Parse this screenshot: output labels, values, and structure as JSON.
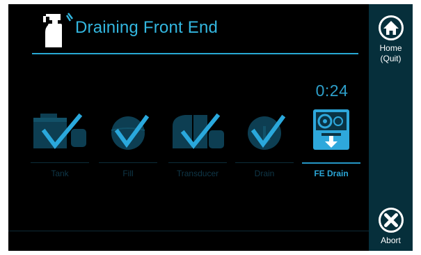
{
  "header": {
    "title": "Draining Front End",
    "icon": "spray-bottle-icon"
  },
  "timer": "0:24",
  "steps": [
    {
      "label": "Tank",
      "icon": "tank-check-icon",
      "state": "done"
    },
    {
      "label": "Fill",
      "icon": "fill-check-icon",
      "state": "done"
    },
    {
      "label": "Transducer",
      "icon": "transducer-check-icon",
      "state": "done"
    },
    {
      "label": "Drain",
      "icon": "drain-check-icon",
      "state": "done"
    },
    {
      "label": "FE Drain",
      "icon": "fe-drain-icon",
      "state": "active"
    }
  ],
  "sidebar": {
    "home": {
      "label_line1": "Home",
      "label_line2": "(Quit)",
      "icon": "home-icon"
    },
    "abort": {
      "label": "Abort",
      "icon": "close-icon"
    }
  },
  "colors": {
    "accent": "#33b7e0",
    "step_done_icon": "#0d3e52",
    "check": "#2aa8dc",
    "sidebar": "#062f3b",
    "background": "#000000"
  }
}
